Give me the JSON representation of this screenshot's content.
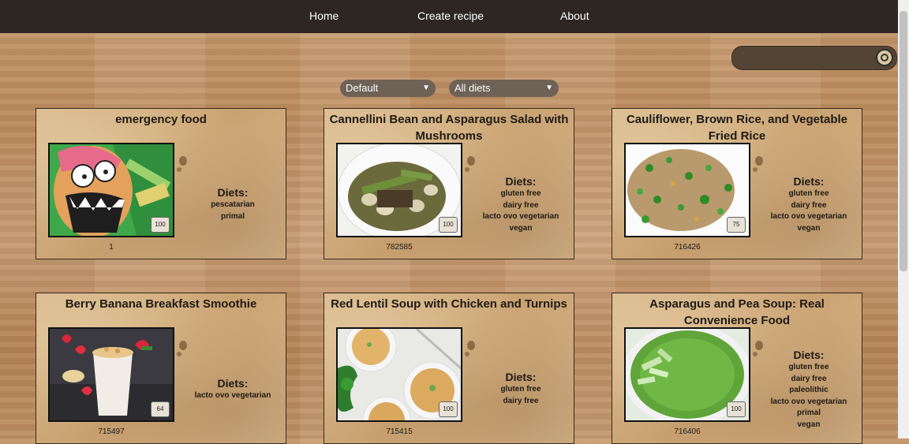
{
  "nav": {
    "home": "Home",
    "create": "Create recipe",
    "about": "About"
  },
  "search": {
    "placeholder": "",
    "icon": "search-icon"
  },
  "filters": {
    "sort": "Default",
    "diet": "All diets"
  },
  "labels": {
    "diets": "Diets:"
  },
  "cards": [
    {
      "title": "emergency food",
      "id": "1",
      "score": "100",
      "diets": [
        "pescatarian",
        "primal"
      ]
    },
    {
      "title": "Cannellini Bean and Asparagus Salad with Mushrooms",
      "id": "782585",
      "score": "100",
      "diets": [
        "gluten free",
        "dairy free",
        "lacto ovo vegetarian",
        "vegan"
      ]
    },
    {
      "title": "Cauliflower, Brown Rice, and Vegetable Fried Rice",
      "id": "716426",
      "score": "75",
      "diets": [
        "gluten free",
        "dairy free",
        "lacto ovo vegetarian",
        "vegan"
      ]
    },
    {
      "title": "Berry Banana Breakfast Smoothie",
      "id": "715497",
      "score": "64",
      "diets": [
        "lacto ovo vegetarian"
      ]
    },
    {
      "title": "Red Lentil Soup with Chicken and Turnips",
      "id": "715415",
      "score": "100",
      "diets": [
        "gluten free",
        "dairy free"
      ]
    },
    {
      "title": "Asparagus and Pea Soup: Real Convenience Food",
      "id": "716406",
      "score": "100",
      "diets": [
        "gluten free",
        "dairy free",
        "paleolithic",
        "lacto ovo vegetarian",
        "primal",
        "vegan"
      ]
    }
  ]
}
